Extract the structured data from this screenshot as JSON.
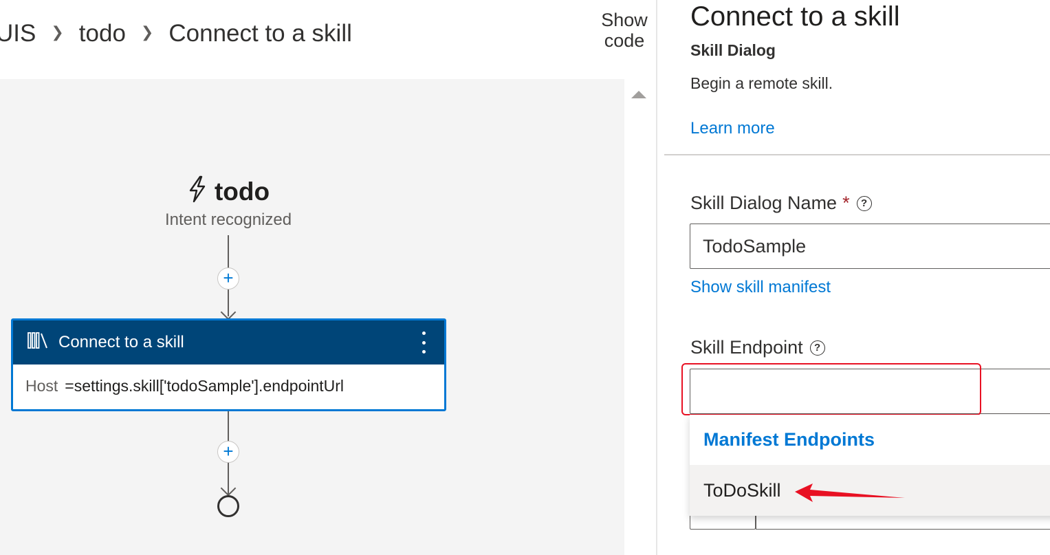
{
  "breadcrumb": {
    "items": [
      "UIS",
      "todo",
      "Connect to a skill"
    ]
  },
  "toolbar": {
    "show_code_line1": "Show",
    "show_code_line2": "code"
  },
  "canvas": {
    "trigger": {
      "icon": "lightning-bolt-icon",
      "title": "todo",
      "subtitle": "Intent recognized"
    },
    "node": {
      "icon": "library-icon",
      "title": "Connect to a skill",
      "property_key": "Host",
      "property_value": "=settings.skill['todoSample'].endpointUrl"
    },
    "add_label": "+"
  },
  "panel": {
    "title": "Connect to a skill",
    "subtitle": "Skill Dialog",
    "description": "Begin a remote skill.",
    "learn_more": "Learn more",
    "fields": {
      "dialog_name": {
        "label": "Skill Dialog Name",
        "required_mark": "*",
        "help_glyph": "?",
        "value": "TodoSample"
      },
      "show_manifest": "Show skill manifest",
      "endpoint": {
        "label": "Skill Endpoint",
        "help_glyph": "?",
        "value": ""
      }
    },
    "dropdown": {
      "header": "Manifest Endpoints",
      "options": [
        "ToDoSkill"
      ]
    }
  },
  "colors": {
    "accent": "#0078d4",
    "node_header": "#004578",
    "annotation": "#e81123"
  }
}
